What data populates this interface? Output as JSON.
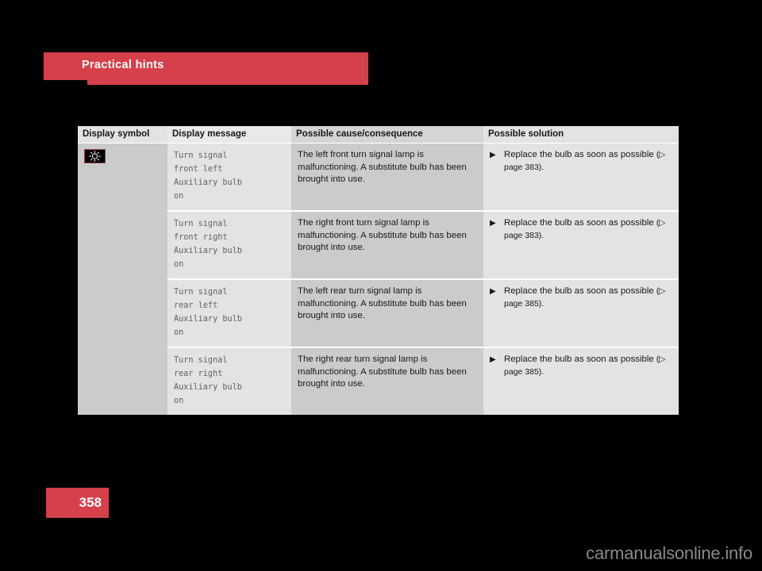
{
  "section": {
    "title": "Practical hints",
    "accent_color": "#d5404b"
  },
  "table": {
    "columns": [
      {
        "key": "symbol",
        "label": "Display symbol"
      },
      {
        "key": "message",
        "label": "Display message"
      },
      {
        "key": "cause",
        "label": "Possible cause/consequence"
      },
      {
        "key": "solution",
        "label": "Possible solution"
      }
    ],
    "rows": [
      {
        "symbol_icon": "bulb-failure-icon",
        "message": "Turn signal\nfront left\nAuxiliary bulb\non",
        "cause": "The left front turn signal lamp is malfunctioning. A substitute bulb has been brought into use.",
        "solution_bullet": "▶",
        "solution": "Replace the bulb as soon as possible",
        "solution_ref_arrow": "▷",
        "solution_ref": "page 383",
        "solution_ref_full": "(▷ page 383)."
      },
      {
        "symbol_icon": "",
        "message": "Turn signal\nfront right\nAuxiliary bulb\non",
        "cause": "The right front turn signal lamp is malfunctioning. A substitute bulb has been brought into use.",
        "solution_bullet": "▶",
        "solution": "Replace the bulb as soon as possible",
        "solution_ref_arrow": "▷",
        "solution_ref": "page 383",
        "solution_ref_full": "(▷ page 383)."
      },
      {
        "symbol_icon": "",
        "message": "Turn signal\nrear left\nAuxiliary bulb\non",
        "cause": "The left rear turn signal lamp is malfunctioning. A substitute bulb has been brought into use.",
        "solution_bullet": "▶",
        "solution": "Replace the bulb as soon as possible",
        "solution_ref_arrow": "▷",
        "solution_ref": "page 385",
        "solution_ref_full": "(▷ page 385)."
      },
      {
        "symbol_icon": "",
        "message": "Turn signal\nrear right\nAuxiliary bulb\non",
        "cause": "The right rear turn signal lamp is malfunctioning. A substitute bulb has been brought into use.",
        "solution_bullet": "▶",
        "solution": "Replace the bulb as soon as possible",
        "solution_ref_arrow": "▷",
        "solution_ref": "page 385",
        "solution_ref_full": "(▷ page 385)."
      }
    ]
  },
  "footer": {
    "page_number": "358",
    "watermark": "carmanualsonline.info"
  }
}
